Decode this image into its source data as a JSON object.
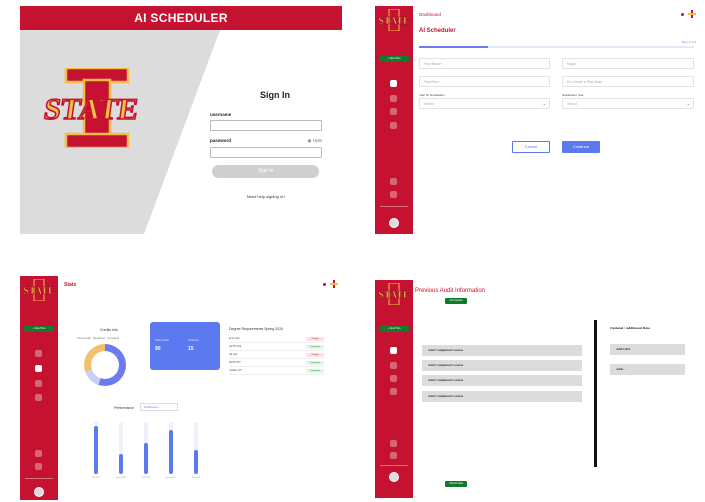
{
  "colors": {
    "brand_red": "#c41230",
    "accent_blue": "#5c79f0",
    "green": "#127a2a",
    "gold": "#f1be48"
  },
  "signin": {
    "app_title": "AI SCHEDULER",
    "heading": "Sign In",
    "username_label": "username",
    "password_label": "password",
    "hide_label": "Hide",
    "signin_button": "Sign In",
    "help_link": "Need help signing in?"
  },
  "scheduler": {
    "breadcrumb": "Dashboard",
    "title": "AI Scheduler",
    "step": "Step 1 of 4",
    "progress": 0.25,
    "fields": {
      "first_name": "First Name",
      "major": "Major",
      "year": "Year/Sem",
      "plan": "Do Create a Plan Date",
      "sem_label": "Year Of Graduation",
      "sem_value": "Select",
      "grad_label": "Graduation Year",
      "grad_value": "Select"
    },
    "cancel_button": "Cancel",
    "continue_button": "Continue"
  },
  "stats": {
    "title": "Stats",
    "credits_title": "Credits Info",
    "legend": [
      "Total Credits",
      "Remaining",
      "Completed"
    ],
    "blue_card": {
      "label1": "Total Credits",
      "value1": "90",
      "label2": "Semester",
      "value2": "15"
    },
    "degree_title": "Degree Requirements Spring 2024",
    "degree_rows": [
      {
        "course": "Econ 202",
        "status": "Pending"
      },
      {
        "course": "ARTIS 209",
        "status": "Completed"
      },
      {
        "course": "SE 422",
        "status": "Pending"
      },
      {
        "course": "MATH 267",
        "status": "Completed"
      },
      {
        "course": "GHIEU 107",
        "status": "Completed"
      }
    ],
    "performance_label": "Performance",
    "performance_select": "Performance",
    "bars": [
      {
        "label": "Fall 2021",
        "value": 0.92
      },
      {
        "label": "Spring 2022",
        "value": 0.38
      },
      {
        "label": "Fall 2022",
        "value": 0.6
      },
      {
        "label": "Spring 2023",
        "value": 0.85
      },
      {
        "label": "Fall 2023",
        "value": 0.46
      }
    ]
  },
  "audit": {
    "title": "Previous Audit Information",
    "top_button": "File Upload",
    "add_rows": [
      "Add Completed Course",
      "Add Completed Course",
      "Add Completed Course",
      "Add Completed Course"
    ],
    "optional_title": "Optional / Additional Data",
    "optional_rows": [
      "Add GPA",
      "Add..."
    ],
    "bottom_button": "Submit Data"
  },
  "sidebar": {
    "new_plan": "+ New Plan",
    "menu_label": "MENU",
    "user_label": "Kimber"
  }
}
